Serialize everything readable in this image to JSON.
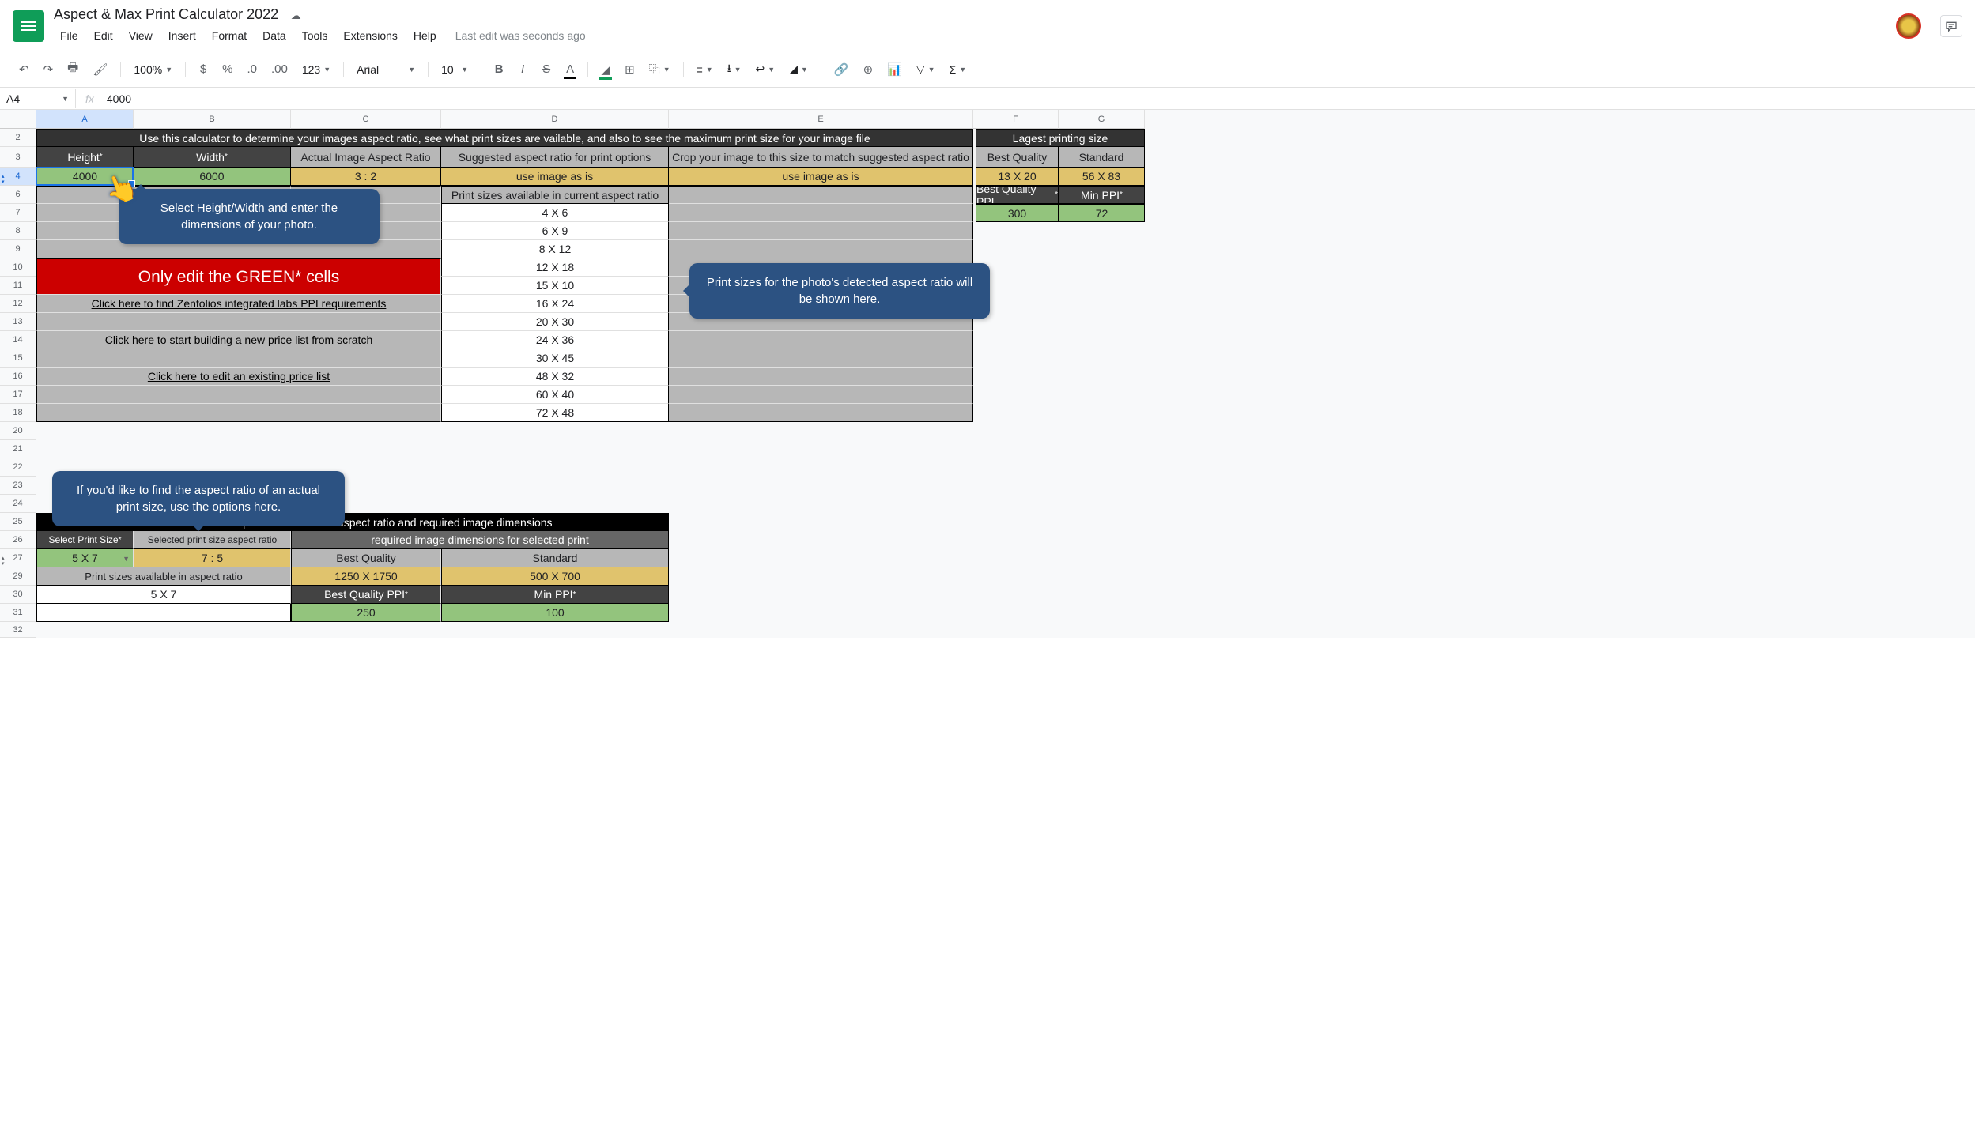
{
  "doc": {
    "title": "Aspect & Max Print Calculator 2022",
    "last_edit": "Last edit was seconds ago"
  },
  "menu": {
    "file": "File",
    "edit": "Edit",
    "view": "View",
    "insert": "Insert",
    "format": "Format",
    "data": "Data",
    "tools": "Tools",
    "extensions": "Extensions",
    "help": "Help"
  },
  "toolbar": {
    "zoom": "100%",
    "font": "Arial",
    "size": "10",
    "numfmt": "123"
  },
  "namebox": "A4",
  "formula": "4000",
  "cols": {
    "A": "A",
    "B": "B",
    "C": "C",
    "D": "D",
    "E": "E",
    "F": "F",
    "G": "G"
  },
  "row_nums": [
    "2",
    "3",
    "4",
    "6",
    "7",
    "8",
    "9",
    "10",
    "11",
    "12",
    "13",
    "14",
    "15",
    "16",
    "17",
    "18",
    "20",
    "21",
    "22",
    "23",
    "24",
    "25",
    "26",
    "27",
    "29",
    "30",
    "31",
    "32"
  ],
  "sheet": {
    "banner": "Use this calculator to determine your images aspect ratio, see what print sizes are vailable, and also to see the maximum print size for your image file",
    "largest_label": "Lagest printing size",
    "row3": {
      "height": "Height",
      "width": "Width",
      "actual": "Actual Image Aspect Ratio",
      "suggested": "Suggested aspect ratio for print options",
      "crop": "Crop your image to this size to match suggested aspect ratio",
      "best": "Best Quality",
      "standard": "Standard"
    },
    "row4": {
      "height_val": "4000",
      "width_val": "6000",
      "ratio": "3 : 2",
      "use1": "use image as is",
      "use2": "use image as is",
      "bq": "13 X 20",
      "std": "56 X 83"
    },
    "row6": {
      "avail": "Print sizes available in current aspect ratio",
      "bqppi": "Best Quality PPI",
      "minppi": "Min PPI"
    },
    "row7": {
      "s": "4 X 6",
      "v300": "300",
      "v72": "72"
    },
    "sizes": [
      "6 X 9",
      "8 X 12",
      "12 X 18",
      "15 X 10",
      "16 X 24",
      "20 X 30",
      "24 X 36",
      "30 X 45",
      "48 X 32",
      "60 X 40",
      "72 X 48"
    ],
    "warn": "Only edit the GREEN* cells",
    "link1": "Click here to find Zenfolios integrated labs PPI requirements",
    "link2": "Click here to start building a new price list from scratch",
    "link3": "Click here to edit an existing price list",
    "lower_banner": "Choose a desired print size to see its aspect ratio and required image dimensions",
    "row26": {
      "select": "Select Print Size",
      "selected": "Selected print size aspect ratio",
      "req": "required image dimensions for selected print"
    },
    "row27": {
      "size": "5 X 7",
      "ratio": "7 : 5",
      "bq": "Best Quality",
      "std": "Standard"
    },
    "row29": {
      "avail": "Print sizes available in aspect ratio",
      "bq": "1250 X 1750",
      "std": "500 X 700"
    },
    "row30": {
      "size": "5 X 7",
      "bqppi": "Best Quality PPI",
      "minppi": "Min PPI"
    },
    "row31": {
      "v250": "250",
      "v100": "100"
    }
  },
  "callouts": {
    "c1": "Select Height/Width and enter the dimensions of your photo.",
    "c2": "Print sizes for the photo's detected aspect ratio will be shown here.",
    "c3": "If you'd like to find the aspect ratio of an actual print size, use the options here."
  }
}
